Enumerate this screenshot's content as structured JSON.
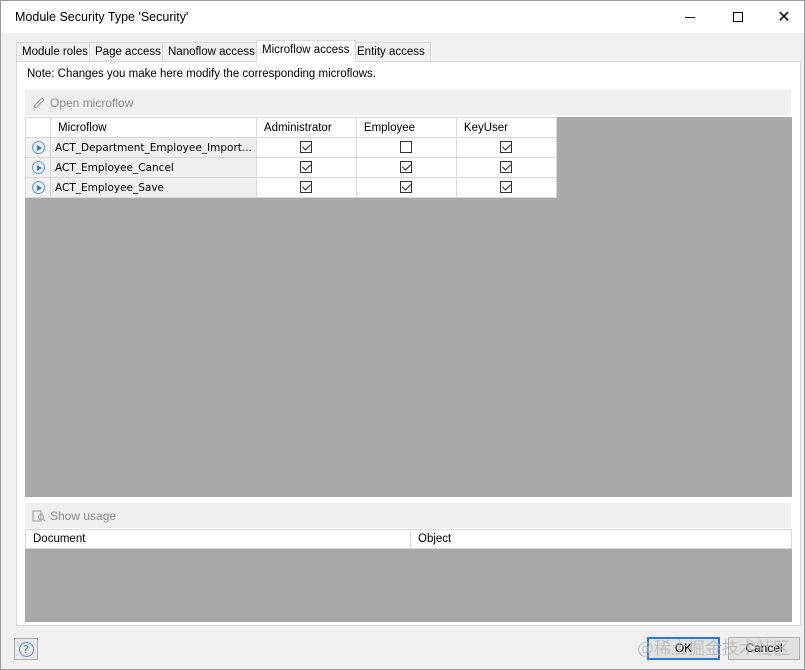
{
  "window": {
    "title": "Module Security Type 'Security'"
  },
  "tabs": [
    {
      "label": "Module roles",
      "active": false
    },
    {
      "label": "Page access",
      "active": false
    },
    {
      "label": "Nanoflow access",
      "active": false
    },
    {
      "label": "Microflow access",
      "active": true
    },
    {
      "label": "Entity access",
      "active": false
    }
  ],
  "note": "Note: Changes you make here modify the corresponding microflows.",
  "toolbar": {
    "open_label": "Open microflow",
    "open_icon": "pencil-icon"
  },
  "grid": {
    "columns": [
      "Microflow",
      "Administrator",
      "Employee",
      "KeyUser"
    ],
    "rows": [
      {
        "name": "ACT_Department_Employee_Import...",
        "icon": "microflow-icon",
        "access": [
          true,
          false,
          true
        ]
      },
      {
        "name": "ACT_Employee_Cancel",
        "icon": "microflow-icon",
        "access": [
          true,
          true,
          true
        ]
      },
      {
        "name": "ACT_Employee_Save",
        "icon": "microflow-icon",
        "access": [
          true,
          true,
          true
        ]
      }
    ]
  },
  "usage": {
    "show_label": "Show usage",
    "show_icon": "show-usage-icon",
    "columns": [
      "Document",
      "Object"
    ]
  },
  "footer": {
    "help_icon": "help-icon",
    "ok_label": "OK",
    "cancel_label": "Cancel"
  },
  "watermark": "@稀土掘金技术社区"
}
